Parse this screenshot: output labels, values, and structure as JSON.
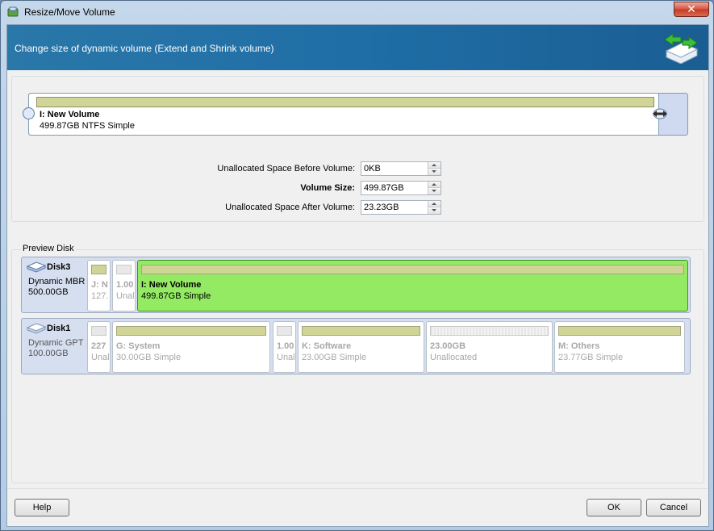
{
  "window": {
    "title": "Resize/Move Volume",
    "close_label": "✕"
  },
  "banner": {
    "text": "Change size of dynamic volume (Extend and Shrink volume)",
    "icon": "resize-arrows-icon"
  },
  "volume": {
    "name": "I: New Volume",
    "info": "499.87GB NTFS Simple"
  },
  "fields": {
    "before_label": "Unallocated Space Before Volume:",
    "before_value": "0KB",
    "size_label": "Volume Size:",
    "size_value": "499.87GB",
    "after_label": "Unallocated Space After Volume:",
    "after_value": "23.23GB"
  },
  "preview": {
    "label": "Preview Disk",
    "disks": [
      {
        "name": "Disk3",
        "type": "Dynamic MBR",
        "size": "500.00GB",
        "partitions": [
          {
            "name": "J: N",
            "info": "127."
          },
          {
            "name": "1.00",
            "info": "Unal"
          },
          {
            "name": "I: New Volume",
            "info": "499.87GB Simple"
          }
        ]
      },
      {
        "name": "Disk1",
        "type": "Dynamic GPT",
        "size": "100.00GB",
        "partitions": [
          {
            "name": "227",
            "info": "Unal"
          },
          {
            "name": "G: System",
            "info": "30.00GB Simple"
          },
          {
            "name": "1.00",
            "info": "Unal"
          },
          {
            "name": "K: Software",
            "info": "23.00GB Simple"
          },
          {
            "name": "23.00GB",
            "info": "Unallocated"
          },
          {
            "name": "M: Others",
            "info": "23.77GB Simple"
          }
        ]
      }
    ]
  },
  "buttons": {
    "help": "Help",
    "ok": "OK",
    "cancel": "Cancel"
  },
  "colors": {
    "banner": "#1f6ea6",
    "selected_partition": "#94eb63",
    "volume_bar": "#d1d497"
  }
}
